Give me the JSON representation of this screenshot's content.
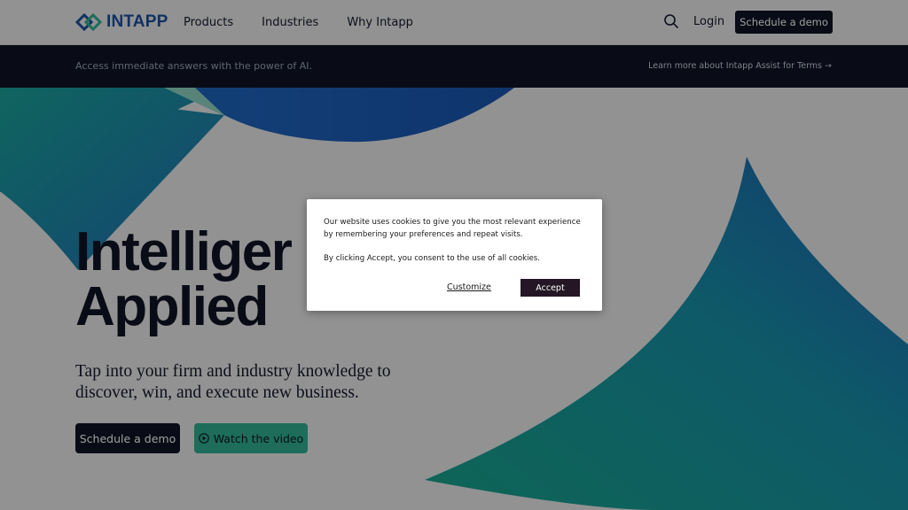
{
  "header": {
    "logo_text": "INTAPP",
    "nav": [
      "Products",
      "Industries",
      "Why Intapp"
    ],
    "login": "Login",
    "cta": "Schedule a demo"
  },
  "banner": {
    "text": "Access immediate answers with the power of AI.",
    "link": "Learn more about Intapp Assist for Terms →"
  },
  "hero": {
    "title": "Intelliger\nApplied",
    "subtitle": "Tap into your firm and industry knowledge to discover, win, and execute new business.",
    "primary_button": "Schedule a demo",
    "secondary_button": "Watch the video"
  },
  "cookie": {
    "paragraph1": "Our website uses cookies to give you the most relevant experience by remembering your preferences and repeat visits.",
    "paragraph2": "By clicking Accept, you consent to the use of all cookies.",
    "customize": "Customize",
    "accept": "Accept"
  },
  "colors": {
    "navy": "#0f1424",
    "brand_blue": "#1a4fa0",
    "teal": "#2fb191",
    "accept_bg": "#241624"
  },
  "icons": [
    "intapp-logo-icon",
    "search-icon",
    "play-icon"
  ]
}
